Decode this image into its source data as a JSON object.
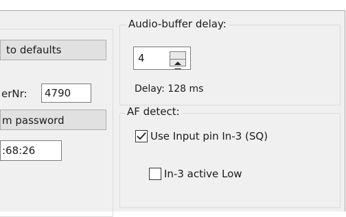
{
  "left_column": {
    "reset_button_label": "to defaults",
    "serial_label": "erNr:",
    "serial_value": "4790",
    "password_button_label": "m password",
    "time_value": ":68:26"
  },
  "audio_buffer": {
    "legend": "Audio-buffer delay:",
    "spinner_value": "4",
    "delay_text": "Delay: 128 ms"
  },
  "af_detect": {
    "legend": "AF detect:",
    "use_input_pin_label": "Use Input pin In-3 (SQ)",
    "use_input_pin_checked": true,
    "active_low_label": "In-3 active Low",
    "active_low_checked": false
  },
  "icons": {
    "spinner_up": "arrow-up-icon",
    "spinner_down": "arrow-down-icon",
    "checkmark": "check-icon"
  }
}
